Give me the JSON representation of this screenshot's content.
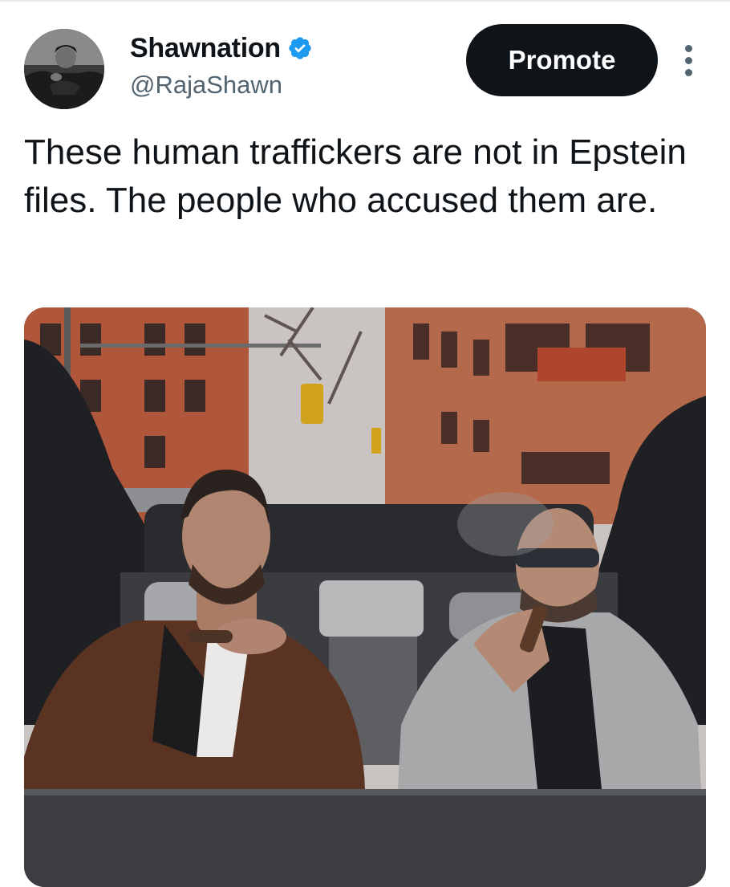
{
  "tweet": {
    "author": {
      "display_name": "Shawnation",
      "handle": "@RajaShawn",
      "verified": true
    },
    "promote_label": "Promote",
    "more_icon": "more-vertical-icon",
    "text": "These human traffickers are not in Epstein files. The people who accused them are."
  },
  "colors": {
    "text_primary": "#0f1419",
    "text_secondary": "#536471",
    "verified_blue": "#1d9bf0",
    "button_bg": "#0f1419"
  }
}
